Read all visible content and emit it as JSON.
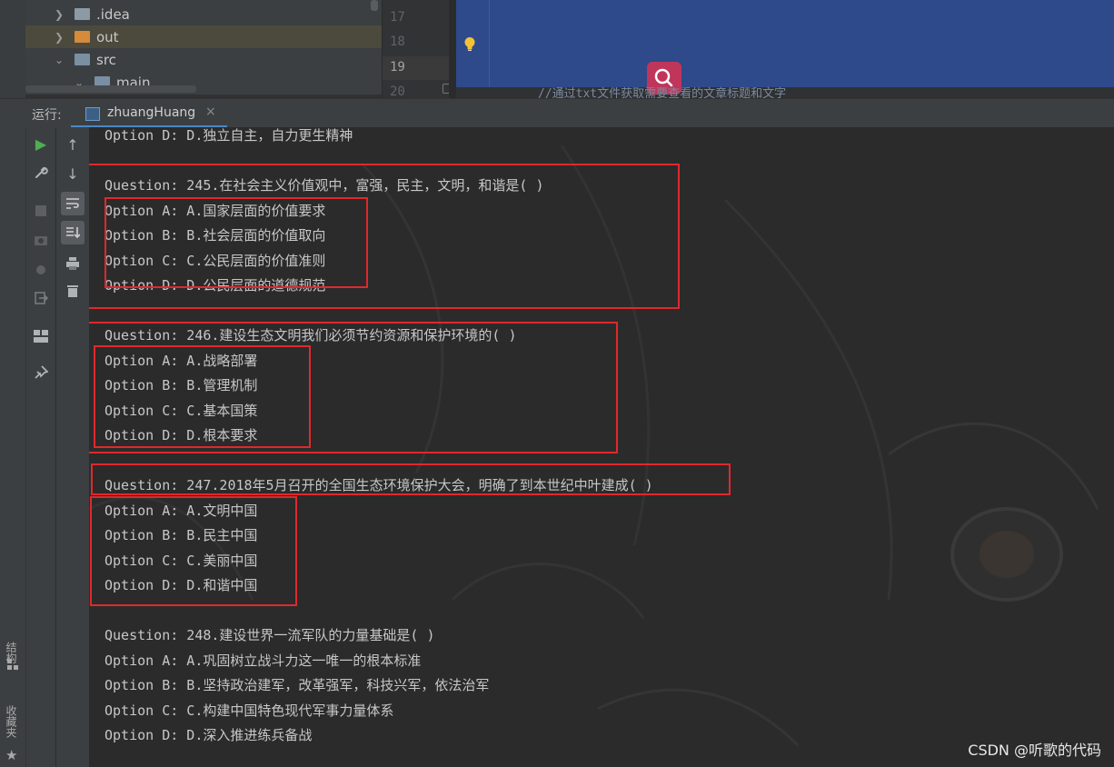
{
  "project_tree": {
    "items": [
      {
        "label": ".idea",
        "icon": "folder-icon"
      },
      {
        "label": "out",
        "icon": "folder-orange-icon"
      },
      {
        "label": "src",
        "icon": "folder-icon"
      },
      {
        "label": "main",
        "icon": "folder-icon"
      }
    ]
  },
  "editor": {
    "line_numbers": [
      "17",
      "18",
      "19",
      "20"
    ],
    "current_line": "19",
    "comment_text": "//通过txt文件获取需要查看的文章标题和文字",
    "accent_color": "#2e4a8a"
  },
  "run_panel": {
    "label": "运行:",
    "tab_label": "zhuangHuang",
    "close_icon": "×"
  },
  "side_tabs": {
    "structure": "结构",
    "favorites": "收藏夹"
  },
  "console": {
    "lines": [
      "Option D: D.独立自主，自力更生精神",
      "",
      "Question: 245.在社会主义价值观中，富强，民主，文明，和谐是( )",
      "Option A: A.国家层面的价值要求",
      "Option B: B.社会层面的价值取向",
      "Option C: C.公民层面的价值准则",
      "Option D: D.公民层面的道德规范",
      "",
      "Question: 246.建设生态文明我们必须节约资源和保护环境的( )",
      "Option A: A.战略部署",
      "Option B: B.管理机制",
      "Option C: C.基本国策",
      "Option D: D.根本要求",
      "",
      "Question: 247.2018年5月召开的全国生态环境保护大会，明确了到本世纪中叶建成( )",
      "Option A: A.文明中国",
      "Option B: B.民主中国",
      "Option C: C.美丽中国",
      "Option D: D.和谐中国",
      "",
      "Question: 248.建设世界一流军队的力量基础是( )",
      "Option A: A.巩固树立战斗力这一唯一的根本标准",
      "Option B: B.坚持政治建军，改革强军，科技兴军，依法治军",
      "Option C: C.构建中国特色现代军事力量体系",
      "Option D: D.深入推进练兵备战"
    ]
  },
  "watermark": "CSDN @听歌的代码",
  "highlight_color": "#e0282c"
}
